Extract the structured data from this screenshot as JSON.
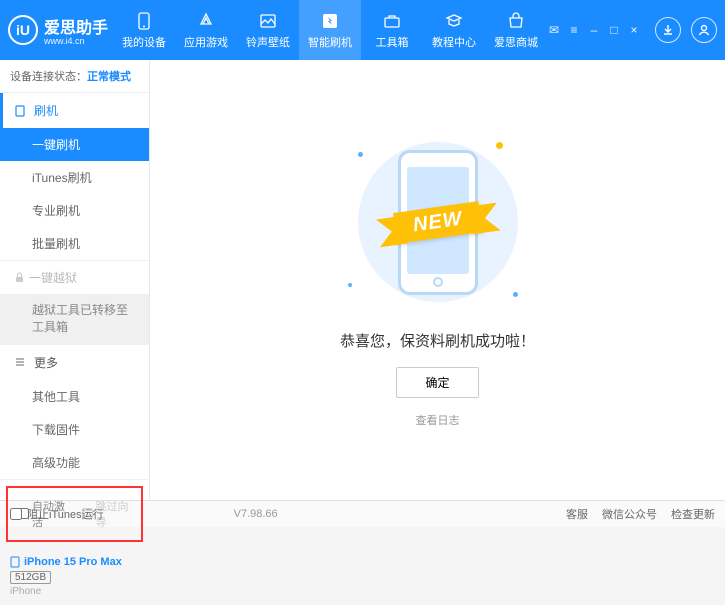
{
  "header": {
    "logo_text": "爱思助手",
    "logo_sub": "www.i4.cn",
    "logo_glyph": "iU",
    "nav": [
      {
        "label": "我的设备"
      },
      {
        "label": "应用游戏"
      },
      {
        "label": "铃声壁纸"
      },
      {
        "label": "智能刷机"
      },
      {
        "label": "工具箱"
      },
      {
        "label": "教程中心"
      },
      {
        "label": "爱思商城"
      }
    ]
  },
  "status": {
    "label": "设备连接状态：",
    "value": "正常模式"
  },
  "sidebar": {
    "flash": {
      "title": "刷机",
      "items": [
        "一键刷机",
        "iTunes刷机",
        "专业刷机",
        "批量刷机"
      ]
    },
    "jailbreak": {
      "title": "一键越狱",
      "note": "越狱工具已转移至工具箱"
    },
    "more": {
      "title": "更多",
      "items": [
        "其他工具",
        "下载固件",
        "高级功能"
      ]
    },
    "chk1": "自动激活",
    "chk2": "跳过向导"
  },
  "device": {
    "name": "iPhone 15 Pro Max",
    "storage": "512GB",
    "type": "iPhone"
  },
  "main": {
    "ribbon": "NEW",
    "message": "恭喜您，保资料刷机成功啦！",
    "ok": "确定",
    "log": "查看日志"
  },
  "footer": {
    "block_itunes": "阻止iTunes运行",
    "version": "V7.98.66",
    "links": [
      "客服",
      "微信公众号",
      "检查更新"
    ]
  }
}
